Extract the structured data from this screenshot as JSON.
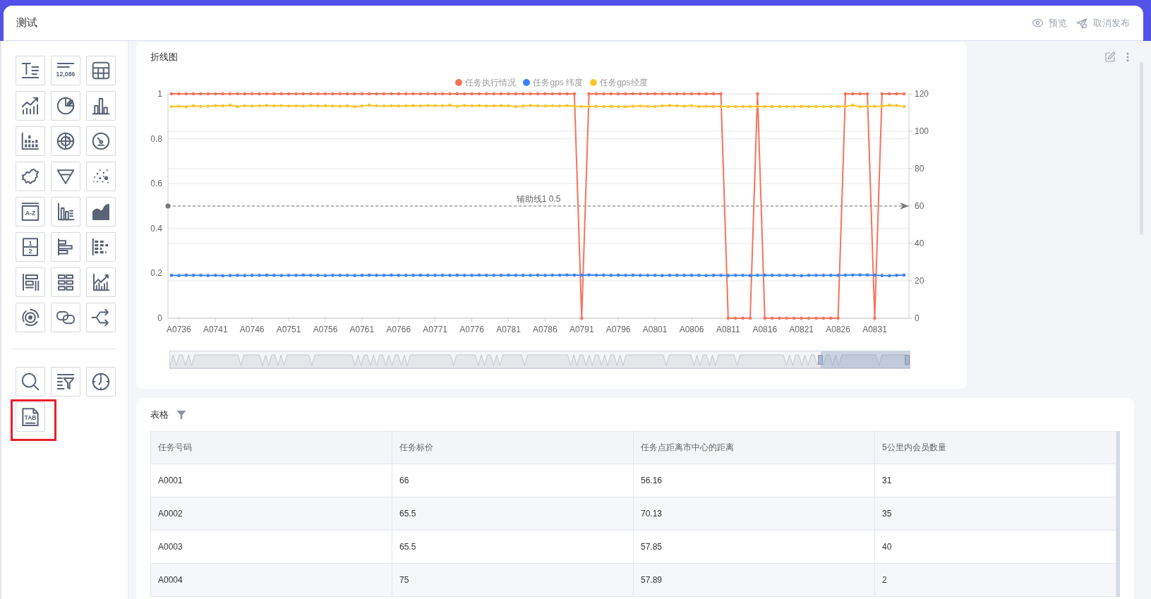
{
  "header": {
    "title": "测试",
    "actions": [
      {
        "kind": "preview",
        "label": "预览"
      },
      {
        "kind": "unpublish",
        "label": "取消发布"
      }
    ]
  },
  "sidebar": {
    "widgets": [
      {
        "kind": "text",
        "selected": false
      },
      {
        "kind": "number",
        "text": "12,086",
        "selected": false
      },
      {
        "kind": "table",
        "selected": false
      },
      {
        "kind": "trend",
        "selected": false
      },
      {
        "kind": "pie",
        "selected": false
      },
      {
        "kind": "bar",
        "selected": false
      },
      {
        "kind": "dot-bar",
        "selected": false
      },
      {
        "kind": "radar",
        "selected": false
      },
      {
        "kind": "gauge",
        "selected": false
      },
      {
        "kind": "map",
        "selected": false
      },
      {
        "kind": "funnel",
        "selected": false
      },
      {
        "kind": "scatter",
        "selected": false
      },
      {
        "kind": "ranking",
        "text": "A-Z",
        "selected": false
      },
      {
        "kind": "grouped-bar",
        "selected": false
      },
      {
        "kind": "area",
        "selected": false
      },
      {
        "kind": "split",
        "texts": [
          "1",
          "2"
        ],
        "selected": false
      },
      {
        "kind": "hbar",
        "selected": false
      },
      {
        "kind": "hstacked",
        "selected": false
      },
      {
        "kind": "bar-list",
        "selected": false
      },
      {
        "kind": "blocks",
        "selected": false
      },
      {
        "kind": "combo",
        "selected": false
      },
      {
        "kind": "ring",
        "selected": false
      },
      {
        "kind": "link",
        "selected": false
      },
      {
        "kind": "flow",
        "selected": false
      }
    ],
    "tools": [
      {
        "kind": "search",
        "selected": false
      },
      {
        "kind": "filter-list",
        "selected": false
      },
      {
        "kind": "clock",
        "selected": false
      },
      {
        "kind": "tab",
        "text": "TAB",
        "selected": true
      }
    ]
  },
  "line_chart": {
    "title": "折线图",
    "chart_data": {
      "type": "line",
      "categories": [
        null,
        "A0736",
        null,
        null,
        null,
        null,
        "A0741",
        null,
        null,
        null,
        null,
        "A0746",
        null,
        null,
        null,
        null,
        "A0751",
        null,
        null,
        null,
        null,
        "A0756",
        null,
        null,
        null,
        null,
        "A0761",
        null,
        null,
        null,
        null,
        "A0766",
        null,
        null,
        null,
        null,
        "A0771",
        null,
        null,
        null,
        null,
        "A0776",
        null,
        null,
        null,
        null,
        "A0781",
        null,
        null,
        null,
        null,
        "A0786",
        null,
        null,
        null,
        null,
        "A0791",
        null,
        null,
        null,
        null,
        "A0796",
        null,
        null,
        null,
        null,
        "A0801",
        null,
        null,
        null,
        null,
        "A0806",
        null,
        null,
        null,
        null,
        "A0811",
        null,
        null,
        null,
        null,
        "A0816",
        null,
        null,
        null,
        null,
        "A0821",
        null,
        null,
        null,
        null,
        "A0826",
        null,
        null,
        null,
        null,
        "A0831",
        null,
        null,
        null,
        null
      ],
      "series": [
        {
          "name": "任务执行情况",
          "color": "#f5735c",
          "values": [
            1,
            1,
            1,
            1,
            1,
            1,
            1,
            1,
            1,
            1,
            1,
            1,
            1,
            1,
            1,
            1,
            1,
            1,
            1,
            1,
            1,
            1,
            1,
            1,
            1,
            1,
            1,
            1,
            1,
            1,
            1,
            1,
            1,
            1,
            1,
            1,
            1,
            1,
            1,
            1,
            1,
            1,
            1,
            1,
            1,
            1,
            1,
            1,
            1,
            1,
            1,
            1,
            1,
            1,
            1,
            1,
            0,
            1,
            1,
            1,
            1,
            1,
            1,
            1,
            1,
            1,
            1,
            1,
            1,
            1,
            1,
            1,
            1,
            1,
            1,
            1,
            0,
            0,
            0,
            0,
            1,
            0,
            0,
            0,
            0,
            0,
            0,
            0,
            0,
            0,
            0,
            0,
            1,
            1,
            1,
            1,
            0,
            1,
            1,
            1,
            1
          ]
        },
        {
          "name": "任务gps 纬度",
          "color": "#3a84f7",
          "axis": "y2",
          "values": [
            22.9,
            22.8,
            23.0,
            22.9,
            22.9,
            22.8,
            22.9,
            22.7,
            22.8,
            22.9,
            22.8,
            22.9,
            22.9,
            23.0,
            22.9,
            22.8,
            22.9,
            22.9,
            23.0,
            22.9,
            22.9,
            22.8,
            22.9,
            22.9,
            22.9,
            22.8,
            22.9,
            23.0,
            22.9,
            22.9,
            23.0,
            22.9,
            22.9,
            22.9,
            23.0,
            22.9,
            22.9,
            22.9,
            22.9,
            23.0,
            22.9,
            22.9,
            23.0,
            22.9,
            22.9,
            22.9,
            23.0,
            22.9,
            22.9,
            22.9,
            23.0,
            22.9,
            23.0,
            23.0,
            23.1,
            23.0,
            23.0,
            23.1,
            23.0,
            23.0,
            22.9,
            23.0,
            22.9,
            23.0,
            22.9,
            22.9,
            22.9,
            22.8,
            22.9,
            22.9,
            22.9,
            22.9,
            22.9,
            22.8,
            22.9,
            22.9,
            22.8,
            22.9,
            22.9,
            22.8,
            22.9,
            23.0,
            22.9,
            22.9,
            22.9,
            22.9,
            22.7,
            22.9,
            22.9,
            22.9,
            22.9,
            22.9,
            23.0,
            23.1,
            23.1,
            23.1,
            23.0,
            22.8,
            22.7,
            22.9,
            23.0
          ]
        },
        {
          "name": "任务gps经度",
          "color": "#fdc72f",
          "axis": "y2",
          "values": [
            113.2,
            113.3,
            113.1,
            113.6,
            113.3,
            113.4,
            113.7,
            113.6,
            113.9,
            113.2,
            113.6,
            113.5,
            113.6,
            113.8,
            113.6,
            113.7,
            113.5,
            113.6,
            113.4,
            113.7,
            113.5,
            113.6,
            113.5,
            113.4,
            113.6,
            113.1,
            113.5,
            113.9,
            113.6,
            113.5,
            113.6,
            113.5,
            113.6,
            113.7,
            113.6,
            113.8,
            113.7,
            113.6,
            113.9,
            113.4,
            113.8,
            113.6,
            113.7,
            113.5,
            113.6,
            113.7,
            113.6,
            113.2,
            113.5,
            113.8,
            113.6,
            113.5,
            113.6,
            113.5,
            113.7,
            113.4,
            113.2,
            113.2,
            113.3,
            113.2,
            113.3,
            113.2,
            113.1,
            113.4,
            113.5,
            113.3,
            113.2,
            113.6,
            113.8,
            113.6,
            113.4,
            113.7,
            113.2,
            113.3,
            113.2,
            113.3,
            113.2,
            113.2,
            113.2,
            113.2,
            113.3,
            113.2,
            113.2,
            113.2,
            113.2,
            113.2,
            113.3,
            113.2,
            113.2,
            113.2,
            113.2,
            113.3,
            113.3,
            113.9,
            113.1,
            113.3,
            113.3,
            113.4,
            113.9,
            113.8,
            113.2
          ]
        }
      ],
      "ylim": [
        0,
        1
      ],
      "yticks": [
        0,
        0.2,
        0.4,
        0.6,
        0.8,
        1
      ],
      "y2lim": [
        0,
        120
      ],
      "y2ticks": [
        0,
        20,
        40,
        60,
        80,
        100,
        120
      ],
      "grid": true,
      "ref_lines": [
        {
          "axis": "y",
          "value": 0.5,
          "label": "辅助线1 0.5"
        }
      ]
    },
    "zoom_slider": {
      "level": 0.12
    }
  },
  "table": {
    "title": "表格",
    "columns": [
      "任务号码",
      "任务标价",
      "任务点距离市中心的距离",
      "5公里内会员数量"
    ],
    "rows": [
      [
        "A0001",
        "66",
        "56.16",
        "31"
      ],
      [
        "A0002",
        "65.5",
        "70.13",
        "35"
      ],
      [
        "A0003",
        "65.5",
        "57.85",
        "40"
      ],
      [
        "A0004",
        "75",
        "57.89",
        "2"
      ]
    ]
  }
}
